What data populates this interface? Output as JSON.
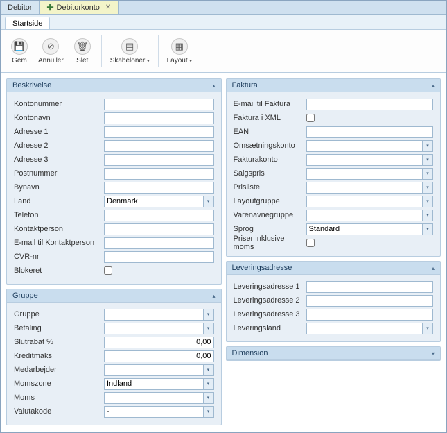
{
  "tabs": {
    "main": "Debitor",
    "active": "Debitorkonto"
  },
  "subtab": "Startside",
  "ribbon": {
    "gem": "Gem",
    "annuller": "Annuller",
    "slet": "Slet",
    "skabeloner": "Skabeloner",
    "layout": "Layout"
  },
  "panels": {
    "beskrivelse": {
      "title": "Beskrivelse",
      "fields": {
        "kontonummer": "Kontonummer",
        "kontonavn": "Kontonavn",
        "adresse1": "Adresse 1",
        "adresse2": "Adresse 2",
        "adresse3": "Adresse 3",
        "postnummer": "Postnummer",
        "bynavn": "Bynavn",
        "land": "Land",
        "telefon": "Telefon",
        "kontaktperson": "Kontaktperson",
        "email_kontakt": "E-mail til Kontaktperson",
        "cvr": "CVR-nr",
        "blokeret": "Blokeret"
      },
      "values": {
        "land": "Denmark"
      }
    },
    "gruppe": {
      "title": "Gruppe",
      "fields": {
        "gruppe": "Gruppe",
        "betaling": "Betaling",
        "slutrabat": "Slutrabat %",
        "kreditmaks": "Kreditmaks",
        "medarbejder": "Medarbejder",
        "momszone": "Momszone",
        "moms": "Moms",
        "valutakode": "Valutakode"
      },
      "values": {
        "slutrabat": "0,00",
        "kreditmaks": "0,00",
        "momszone": "Indland",
        "valutakode": "-"
      }
    },
    "faktura": {
      "title": "Faktura",
      "fields": {
        "email_faktura": "E-mail til Faktura",
        "faktura_xml": "Faktura i XML",
        "ean": "EAN",
        "omsaetning": "Omsætningskonto",
        "fakturakonto": "Fakturakonto",
        "salgspris": "Salgspris",
        "prisliste": "Prisliste",
        "layoutgruppe": "Layoutgruppe",
        "varenavnegruppe": "Varenavnegruppe",
        "sprog": "Sprog",
        "priser_moms": "Priser inklusive moms"
      },
      "values": {
        "sprog": "Standard"
      }
    },
    "levering": {
      "title": "Leveringsadresse",
      "fields": {
        "lev1": "Leveringsadresse 1",
        "lev2": "Leveringsadresse 2",
        "lev3": "Leveringsadresse 3",
        "levland": "Leveringsland"
      }
    },
    "dimension": {
      "title": "Dimension"
    }
  }
}
